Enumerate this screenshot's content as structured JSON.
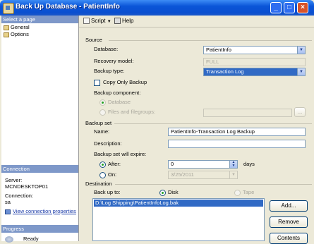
{
  "window": {
    "title": "Back Up Database - PatientInfo"
  },
  "left_pane": {
    "select_page_header": "Select a page",
    "pages": [
      {
        "label": "General"
      },
      {
        "label": "Options"
      }
    ],
    "connection_header": "Connection",
    "server_label": "Server:",
    "server_value": "MCNDESKTOP01",
    "connection_label": "Connection:",
    "connection_value": "sa",
    "view_connection_properties": "View connection properties",
    "progress_header": "Progress",
    "progress_status": "Ready"
  },
  "toolbar": {
    "script_label": "Script",
    "help_label": "Help"
  },
  "source": {
    "group_label": "Source",
    "database_label": "Database:",
    "database_value": "PatientInfo",
    "recovery_model_label": "Recovery model:",
    "recovery_model_value": "FULL",
    "backup_type_label": "Backup type:",
    "backup_type_value": "Transaction Log",
    "copy_only_label": "Copy Only Backup",
    "backup_component_label": "Backup component:",
    "component_database_label": "Database",
    "component_files_label": "Files and filegroups:",
    "files_button_label": "..."
  },
  "backup_set": {
    "group_label": "Backup set",
    "name_label": "Name:",
    "name_value": "PatientInfo-Transaction Log  Backup",
    "description_label": "Description:",
    "description_value": "",
    "expire_label": "Backup set will expire:",
    "after_label": "After:",
    "after_value": "0",
    "days_label": "days",
    "on_label": "On:",
    "on_value": "3/25/2011"
  },
  "destination": {
    "group_label": "Destination",
    "back_up_to_label": "Back up to:",
    "disk_label": "Disk",
    "tape_label": "Tape",
    "paths": [
      "D:\\Log Shipping\\PatientInfoLog.bak"
    ],
    "add_button": "Add...",
    "remove_button": "Remove",
    "contents_button": "Contents"
  }
}
